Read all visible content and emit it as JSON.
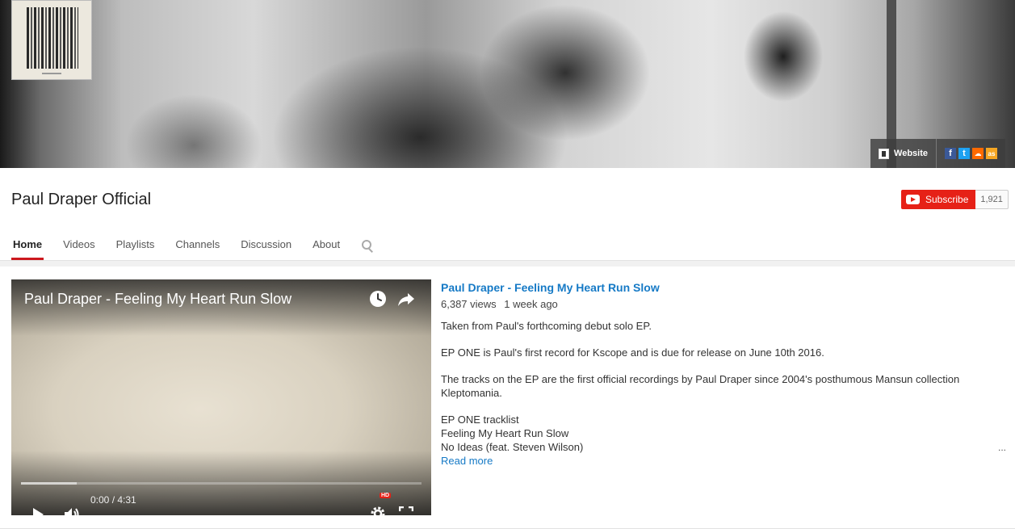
{
  "banner": {
    "website_label": "Website",
    "social": [
      {
        "name": "facebook-icon",
        "glyph": "f"
      },
      {
        "name": "twitter-icon",
        "glyph": "t"
      },
      {
        "name": "soundcloud-icon",
        "glyph": "☁"
      },
      {
        "name": "lastfm-icon",
        "glyph": "as"
      }
    ]
  },
  "channel": {
    "title": "Paul Draper Official",
    "subscribe_label": "Subscribe",
    "subscriber_count": "1,921"
  },
  "tabs": [
    "Home",
    "Videos",
    "Playlists",
    "Channels",
    "Discussion",
    "About"
  ],
  "active_tab": "Home",
  "player": {
    "title": "Paul Draper - Feeling My Heart Run Slow",
    "time": "0:00 / 4:31",
    "hd_badge": "HD",
    "loaded_fraction": 0.14
  },
  "video": {
    "title": "Paul Draper - Feeling My Heart Run Slow",
    "views": "6,387 views",
    "age": "1 week ago",
    "description": [
      "Taken from Paul's forthcoming debut solo EP.",
      "EP ONE is Paul's first record for Kscope and is due for release on June 10th 2016.",
      "The tracks on the EP are the first official recordings by Paul Draper since 2004's posthumous Mansun collection Kleptomania."
    ],
    "tracklist_heading": "EP ONE tracklist",
    "tracks": [
      "Feeling My Heart Run Slow",
      "No Ideas (feat. Steven Wilson)"
    ],
    "read_more": "Read more",
    "ellipsis": "..."
  },
  "colors": {
    "accent_red": "#e62117",
    "link_blue": "#167ac6",
    "tab_underline": "#cc181e"
  }
}
